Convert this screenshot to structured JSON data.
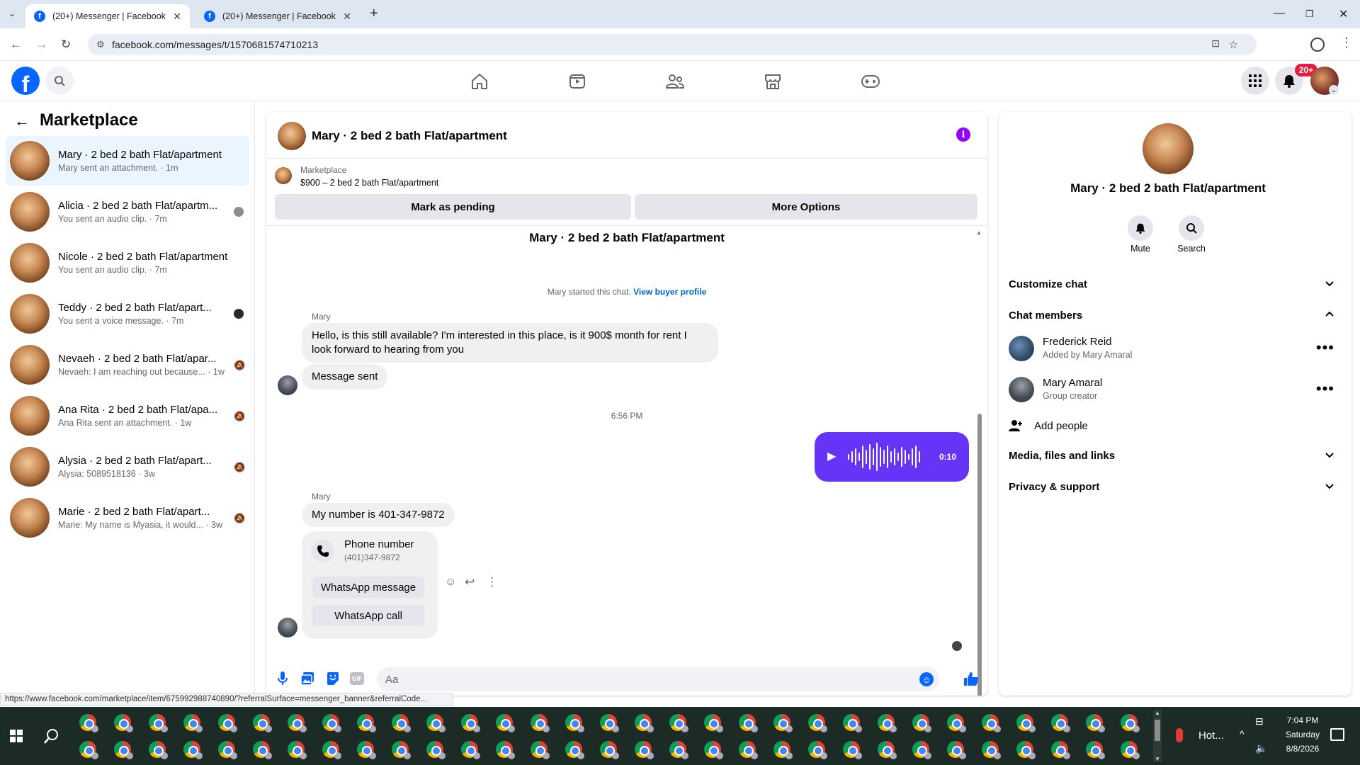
{
  "browser": {
    "tabs": [
      {
        "title": "(20+) Messenger | Facebook"
      },
      {
        "title": "(20+) Messenger | Facebook"
      }
    ],
    "url": "facebook.com/messages/t/1570681574710213",
    "status_url": "https://www.facebook.com/marketplace/item/675992988740890/?referralSurface=messenger_banner&referralCode..."
  },
  "fb": {
    "notif_badge": "20+"
  },
  "left": {
    "title": "Marketplace",
    "conversations": [
      {
        "name": "Mary · 2 bed 2 bath Flat/apartment",
        "preview": "Mary sent an attachment. · 1m",
        "mark": "none"
      },
      {
        "name": "Alicia · 2 bed 2 bath Flat/apartm...",
        "preview": "You sent an audio clip. · 7m",
        "mark": "seen"
      },
      {
        "name": "Nicole · 2 bed 2 bath Flat/apartment",
        "preview": "You sent an audio clip. · 7m",
        "mark": "none"
      },
      {
        "name": "Teddy · 2 bed 2 bath Flat/apart...",
        "preview": "You sent a voice message. · 7m",
        "mark": "seen-dark"
      },
      {
        "name": "Nevaeh · 2 bed 2 bath Flat/apar...",
        "preview": "Nevaeh: I am reaching out because... · 1w",
        "mark": "muted"
      },
      {
        "name": "Ana Rita · 2 bed 2 bath Flat/apa...",
        "preview": "Ana Rita sent an attachment. · 1w",
        "mark": "muted"
      },
      {
        "name": "Alysia · 2 bed 2 bath Flat/apart...",
        "preview": "Alysia: 5089518136 · 3w",
        "mark": "muted"
      },
      {
        "name": "Marie · 2 bed 2 bath Flat/apart...",
        "preview": "Marie: My name is Myasia, it would... · 3w",
        "mark": "muted"
      }
    ]
  },
  "chat": {
    "header_title": "Mary · 2 bed 2 bath Flat/apartment",
    "banner_label": "Marketplace",
    "banner_listing": "$900 – 2 bed 2 bath Flat/apartment",
    "mark_pending": "Mark as pending",
    "more_options": "More Options",
    "thread_title": "Mary · 2 bed 2 bath Flat/apartment",
    "started_text": "Mary started this chat.",
    "view_buyer": "View buyer profile",
    "sender1": "Mary",
    "msg1": "Hello, is this still available? I'm interested in this place, is it 900$ month for rent I look forward to hearing from you",
    "msg2": "Message sent",
    "time_divider": "6:56 PM",
    "audio_duration": "0:10",
    "sender2": "Mary",
    "msg3": "My number is 401-347-9872",
    "phone_title": "Phone number",
    "phone_value": "(401)347-9872",
    "whatsapp_message": "WhatsApp message",
    "whatsapp_call": "WhatsApp call",
    "composer_placeholder": "Aa"
  },
  "right": {
    "title": "Mary · 2 bed 2 bath Flat/apartment",
    "mute": "Mute",
    "search": "Search",
    "customize": "Customize chat",
    "members_header": "Chat members",
    "members": [
      {
        "name": "Frederick Reid",
        "sub": "Added by Mary Amaral"
      },
      {
        "name": "Mary Amaral",
        "sub": "Group creator"
      }
    ],
    "add_people": "Add people",
    "media": "Media, files and links",
    "privacy": "Privacy & support"
  },
  "taskbar": {
    "weather": "Hot...",
    "time": "7:04 PM",
    "day": "Saturday",
    "date": "8/8/2026"
  },
  "colors": {
    "fb_blue": "#0866ff",
    "messenger_purple": "#6634f6",
    "selected_row": "#ebf5ff"
  }
}
